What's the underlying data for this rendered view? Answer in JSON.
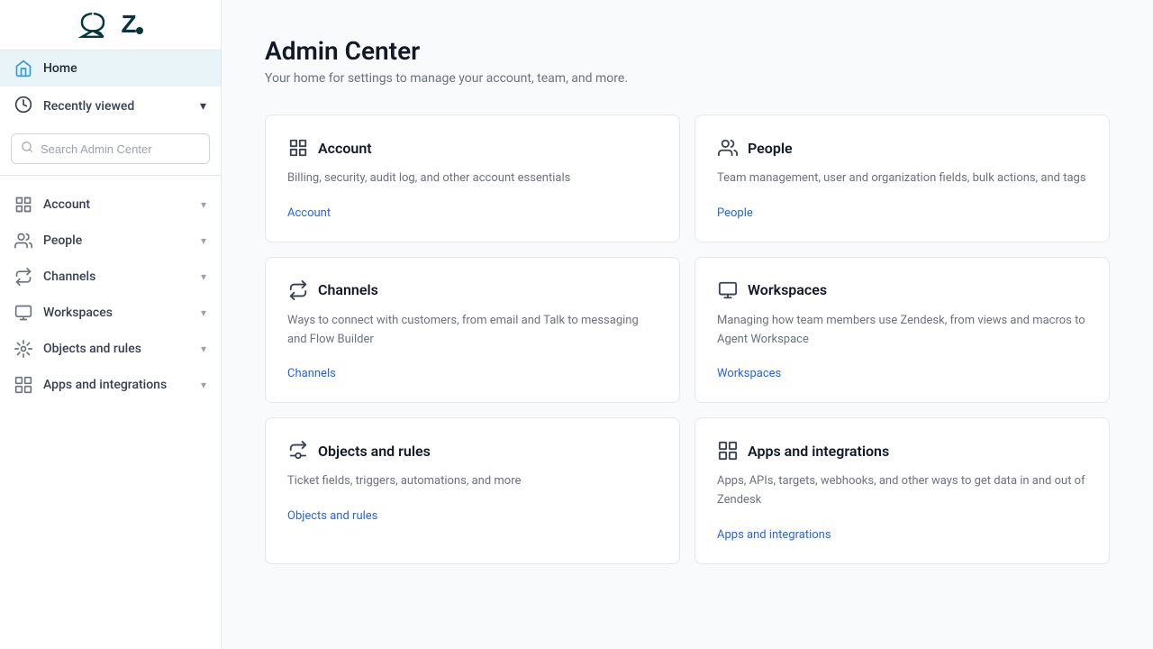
{
  "sidebar": {
    "logo_alt": "Zendesk logo",
    "home_label": "Home",
    "recently_viewed_label": "Recently viewed",
    "search_placeholder": "Search Admin Center",
    "nav_items": [
      {
        "id": "account",
        "label": "Account"
      },
      {
        "id": "people",
        "label": "People"
      },
      {
        "id": "channels",
        "label": "Channels"
      },
      {
        "id": "workspaces",
        "label": "Workspaces"
      },
      {
        "id": "objects-and-rules",
        "label": "Objects and rules"
      },
      {
        "id": "apps-and-integrations",
        "label": "Apps and integrations"
      }
    ]
  },
  "main": {
    "title": "Admin Center",
    "subtitle": "Your home for settings to manage your account, team, and more.",
    "cards": [
      {
        "id": "account",
        "title": "Account",
        "description": "Billing, security, audit log, and other account essentials",
        "link_label": "Account"
      },
      {
        "id": "people",
        "title": "People",
        "description": "Team management, user and organization fields, bulk actions, and tags",
        "link_label": "People"
      },
      {
        "id": "channels",
        "title": "Channels",
        "description": "Ways to connect with customers, from email and Talk to messaging and Flow Builder",
        "link_label": "Channels"
      },
      {
        "id": "workspaces",
        "title": "Workspaces",
        "description": "Managing how team members use Zendesk, from views and macros to Agent Workspace",
        "link_label": "Workspaces"
      },
      {
        "id": "objects-and-rules",
        "title": "Objects and rules",
        "description": "Ticket fields, triggers, automations, and more",
        "link_label": "Objects and rules"
      },
      {
        "id": "apps-and-integrations",
        "title": "Apps and integrations",
        "description": "Apps, APIs, targets, webhooks, and other ways to get data in and out of Zendesk",
        "link_label": "Apps and integrations"
      }
    ]
  },
  "colors": {
    "accent": "#2563eb",
    "sidebar_active_bg": "#e8f4f8",
    "icon_active": "#2d9cdb"
  }
}
